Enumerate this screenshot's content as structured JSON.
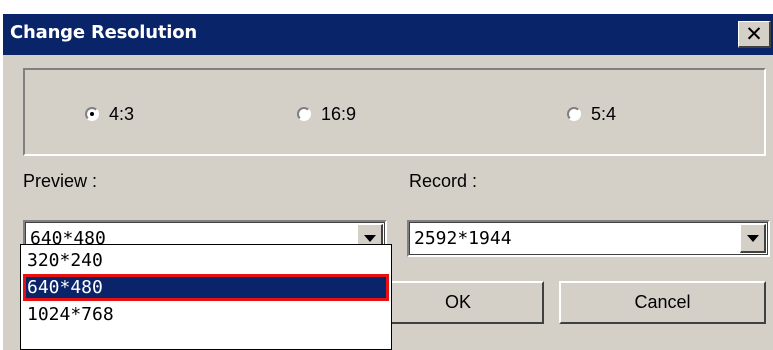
{
  "window": {
    "title": "Change Resolution",
    "close_glyph": "✕"
  },
  "ratio": {
    "options": [
      {
        "label": "4:3",
        "selected": true
      },
      {
        "label": "16:9",
        "selected": false
      },
      {
        "label": "5:4",
        "selected": false
      }
    ]
  },
  "preview": {
    "label": "Preview :",
    "value": "640*480"
  },
  "record": {
    "label": "Record :",
    "value": "2592*1944"
  },
  "dropdown": {
    "items": [
      {
        "label": "320*240",
        "highlighted": false
      },
      {
        "label": "640*480",
        "highlighted": true
      },
      {
        "label": "1024*768",
        "highlighted": false
      }
    ],
    "highlight_color": "#0a246a",
    "highlight_border_color": "#e81010"
  },
  "buttons": {
    "ok": "OK",
    "cancel": "Cancel"
  },
  "colors": {
    "titlebar": "#0a246a",
    "face": "#d4d0c8"
  }
}
